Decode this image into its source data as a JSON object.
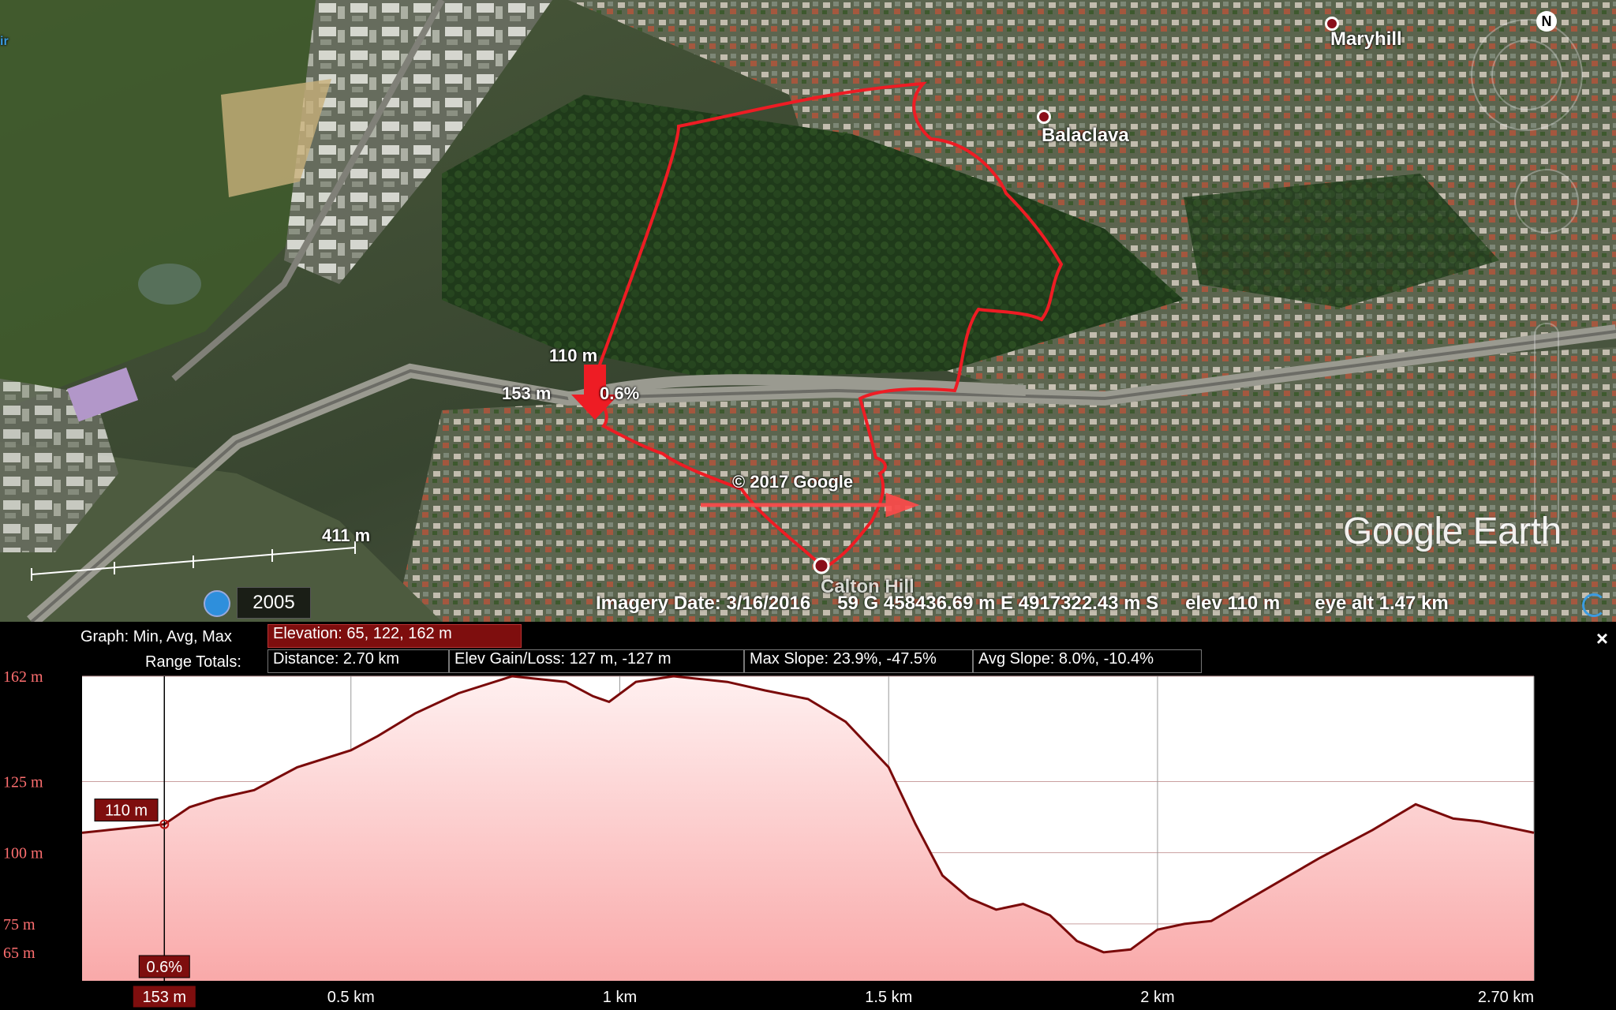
{
  "map": {
    "places": [
      {
        "name": "Maryhill"
      },
      {
        "name": "Balaclava"
      },
      {
        "name": "Calton Hill"
      }
    ],
    "cursor_labels": {
      "elevation": "110 m",
      "distance": "153 m",
      "slope": "0.6%"
    },
    "scale_label": "411 m",
    "copyright": "© 2017 Google",
    "logo": "Google Earth",
    "compass_label": "N",
    "historical_year": "2005",
    "status": {
      "imagery_date": "Imagery Date: 3/16/2016",
      "coords": "59 G 458436.69 m E 4917322.43 m S",
      "elev": "elev   110 m",
      "eye_alt": "eye alt   1.47 km"
    },
    "left_edge_fragment": "ir",
    "colors": {
      "path": "#ee1c24",
      "pin": "#8a0f1a"
    }
  },
  "panel": {
    "graph_label": "Graph: Min, Avg, Max",
    "elevation_chip": "Elevation: 65, 122, 162 m",
    "range_label": "Range Totals:",
    "distance_chip": "Distance: 2.70 km",
    "gain_chip": "Elev Gain/Loss: 127 m, -127 m",
    "max_slope_chip": "Max Slope: 23.9%, -47.5%",
    "avg_slope_chip": "Avg Slope: 8.0%, -10.4%",
    "close_label": "×"
  },
  "chart_data": {
    "type": "area",
    "title": "",
    "xlabel": "",
    "ylabel": "",
    "x_unit": "km",
    "y_unit": "m",
    "xlim": [
      0,
      2.7
    ],
    "ylim": [
      55,
      162
    ],
    "y_ticks": [
      {
        "value": 162,
        "label": "162 m"
      },
      {
        "value": 125,
        "label": "125 m"
      },
      {
        "value": 100,
        "label": "100 m"
      },
      {
        "value": 75,
        "label": "75 m"
      },
      {
        "value": 65,
        "label": "65 m"
      }
    ],
    "x_ticks": [
      {
        "value": 0.5,
        "label": "0.5 km"
      },
      {
        "value": 1.0,
        "label": "1 km"
      },
      {
        "value": 1.5,
        "label": "1.5 km"
      },
      {
        "value": 2.0,
        "label": "2 km"
      },
      {
        "value": 2.7,
        "label": "2.70 km"
      }
    ],
    "x": [
      0,
      0.05,
      0.1,
      0.153,
      0.2,
      0.25,
      0.32,
      0.4,
      0.5,
      0.55,
      0.62,
      0.7,
      0.8,
      0.9,
      0.95,
      0.98,
      1.03,
      1.1,
      1.2,
      1.27,
      1.35,
      1.42,
      1.5,
      1.55,
      1.6,
      1.65,
      1.7,
      1.75,
      1.8,
      1.85,
      1.9,
      1.95,
      2.0,
      2.05,
      2.1,
      2.2,
      2.3,
      2.4,
      2.48,
      2.55,
      2.6,
      2.65,
      2.7
    ],
    "y": [
      107,
      108,
      109,
      110,
      116,
      119,
      122,
      130,
      136,
      141,
      149,
      156,
      162,
      160,
      155,
      153,
      160,
      162,
      160,
      157,
      154,
      146,
      130,
      110,
      92,
      84,
      80,
      82,
      78,
      69,
      65,
      66,
      73,
      75,
      76,
      87,
      98,
      108,
      117,
      112,
      111,
      109,
      107
    ],
    "cursor": {
      "distance": 0.153,
      "distance_label": "153 m",
      "elevation_label": "110 m",
      "slope_label": "0.6%"
    },
    "grid": true,
    "colors": {
      "line": "#7a0a0a",
      "fill_top": "#fff0f0",
      "fill_bottom": "#f9a9a9",
      "grid": "#c9a0a0"
    }
  }
}
